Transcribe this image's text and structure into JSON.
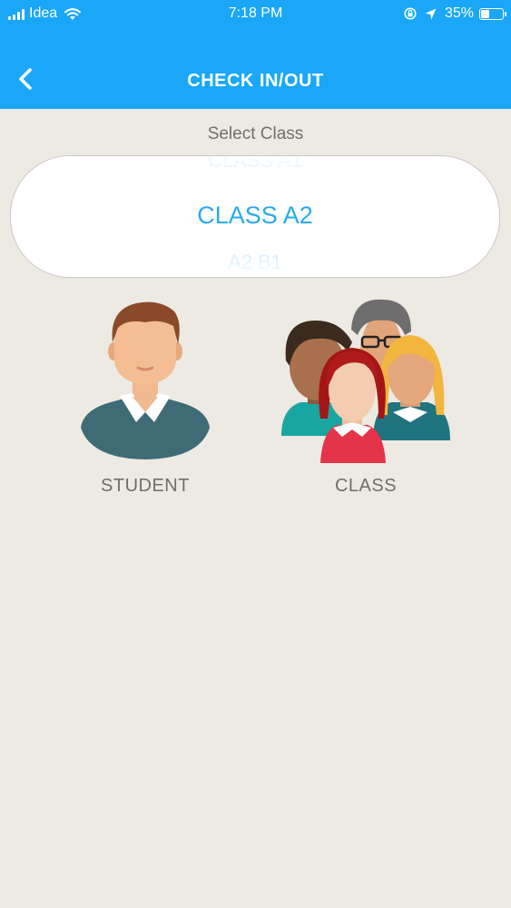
{
  "status_bar": {
    "carrier": "Idea",
    "time": "7:18 PM",
    "battery": "35%",
    "battery_level": 0.35,
    "icons": [
      "signal-icon",
      "wifi-icon",
      "lock-rotation-icon",
      "location-arrow-icon",
      "battery-icon"
    ]
  },
  "nav": {
    "title": "CHECK IN/OUT",
    "back_icon": "chevron-left-icon"
  },
  "select": {
    "label": "Select Class",
    "selected": "CLASS A2",
    "prev_partial": "CLASS A1",
    "next_partial": "A2 B1"
  },
  "options": {
    "student_label": "STUDENT",
    "class_label": "CLASS"
  },
  "colors": {
    "accent": "#1aa7f8",
    "picker_text": "#29aaf0",
    "background": "#eceae2"
  }
}
